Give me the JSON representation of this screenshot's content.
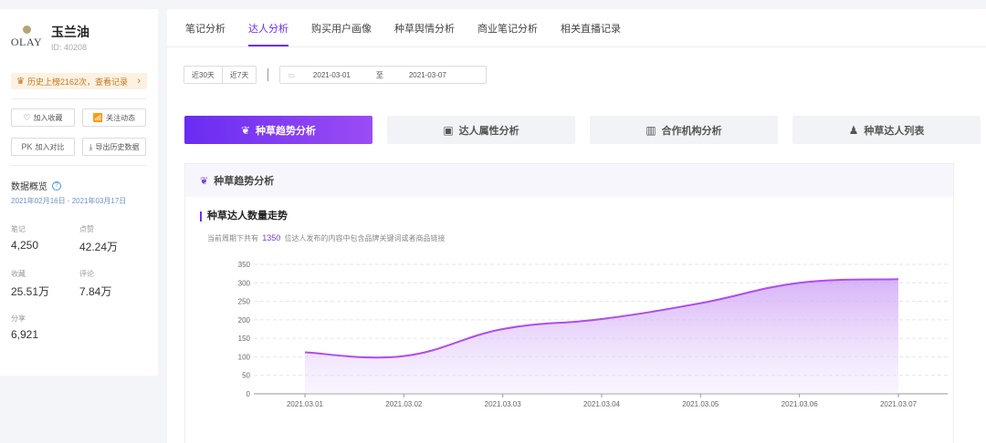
{
  "brand": {
    "logo_text": "OLAY",
    "name": "玉兰油",
    "id_text": "ID: 40208"
  },
  "history": {
    "text": "历史上榜2162次，查看记录",
    "arrow": "›"
  },
  "actions": [
    {
      "icon": "♡",
      "label": "加入收藏"
    },
    {
      "icon": "📶",
      "label": "关注动态"
    },
    {
      "icon": "PK",
      "label": "加入对比"
    },
    {
      "icon": "⤓",
      "label": "导出历史数据"
    }
  ],
  "overview": {
    "title": "数据概览",
    "help": "?",
    "range": "2021年02月16日 - 2021年03月17日",
    "stats": [
      {
        "label": "笔记",
        "value": "4,250"
      },
      {
        "label": "点赞",
        "value": "42.24万"
      },
      {
        "label": "收藏",
        "value": "25.51万"
      },
      {
        "label": "评论",
        "value": "7.84万"
      },
      {
        "label": "分享",
        "value": "6,921"
      }
    ]
  },
  "top_tabs": [
    "笔记分析",
    "达人分析",
    "购买用户画像",
    "种草舆情分析",
    "商业笔记分析",
    "相关直播记录"
  ],
  "top_tab_active": 1,
  "filter": {
    "quick": [
      "近30天",
      "近7天"
    ],
    "calendar_icon": "▭",
    "start": "2021-03-01",
    "to": "至",
    "end": "2021-03-07"
  },
  "big_tabs": [
    {
      "icon": "❦",
      "label": "种草趋势分析"
    },
    {
      "icon": "▣",
      "label": "达人属性分析"
    },
    {
      "icon": "▥",
      "label": "合作机构分析"
    },
    {
      "icon": "♟",
      "label": "种草达人列表"
    }
  ],
  "big_tab_active": 0,
  "panel": {
    "title": "种草趋势分析",
    "icon": "❦",
    "sub_title": "种草达人数量走势",
    "desc_prefix": "当前周期下共有",
    "desc_num": "1350",
    "desc_suffix": "位达人发布的内容中包含品牌关键词或者商品链接"
  },
  "colors": {
    "accent": "#6d2cff",
    "line": "#b04cf0",
    "fill": "#d9b8f8"
  },
  "chart_data": {
    "type": "area",
    "categories": [
      "2021.03.01",
      "2021.03.02",
      "2021.03.03",
      "2021.03.04",
      "2021.03.05",
      "2021.03.06",
      "2021.03.07"
    ],
    "series": [
      {
        "values": [
          112,
          102,
          175,
          202,
          245,
          300,
          310
        ]
      }
    ],
    "yticks": [
      0,
      50,
      100,
      150,
      200,
      250,
      300,
      350
    ],
    "ylim": [
      0,
      350
    ],
    "grid": true
  }
}
